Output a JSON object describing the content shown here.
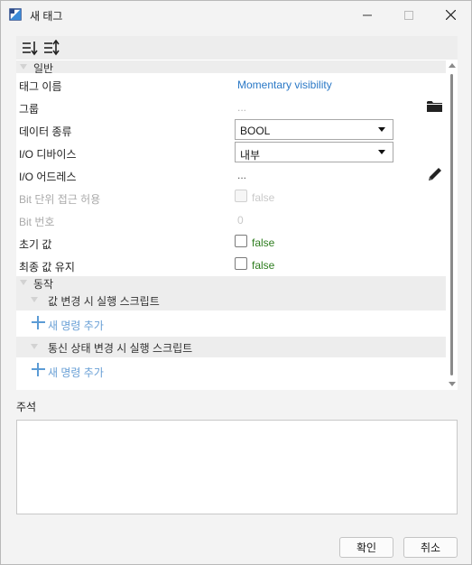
{
  "window": {
    "title": "새 태그"
  },
  "sections": {
    "general": "일반",
    "behavior": "동작"
  },
  "properties": {
    "tag_name": {
      "label": "태그 이름",
      "value": "Momentary visibility"
    },
    "group": {
      "label": "그룹",
      "value": "..."
    },
    "data_type": {
      "label": "데이터 종류",
      "value": "BOOL"
    },
    "io_device": {
      "label": "I/O 디바이스",
      "value": "내부"
    },
    "io_address": {
      "label": "I/O 어드레스",
      "value": "..."
    },
    "bit_access": {
      "label": "Bit 단위 접근 허용",
      "value": "false"
    },
    "bit_number": {
      "label": "Bit 번호",
      "value": "0"
    },
    "initial_value": {
      "label": "초기 값",
      "value": "false"
    },
    "retain_last": {
      "label": "최종 값 유지",
      "value": "false"
    }
  },
  "scripts": {
    "on_value_change": "값 변경 시 실행 스크립트",
    "on_comm_change": "통신 상태 변경 시 실행 스크립트",
    "add_command": "새 명령 추가"
  },
  "comment": {
    "label": "주석",
    "value": ""
  },
  "buttons": {
    "ok": "확인",
    "cancel": "취소"
  },
  "colors": {
    "link": "#2a78c6",
    "bool_value": "#2e7d1f",
    "section_bg": "#ededed",
    "add_icon": "#5b9bd5"
  },
  "icons": {
    "app": "app-logo-icon",
    "group_browse": "folder-icon",
    "address_edit": "pencil-icon",
    "sort_categorized": "sort-categorized-icon",
    "sort_alpha": "sort-alphabetical-icon"
  }
}
